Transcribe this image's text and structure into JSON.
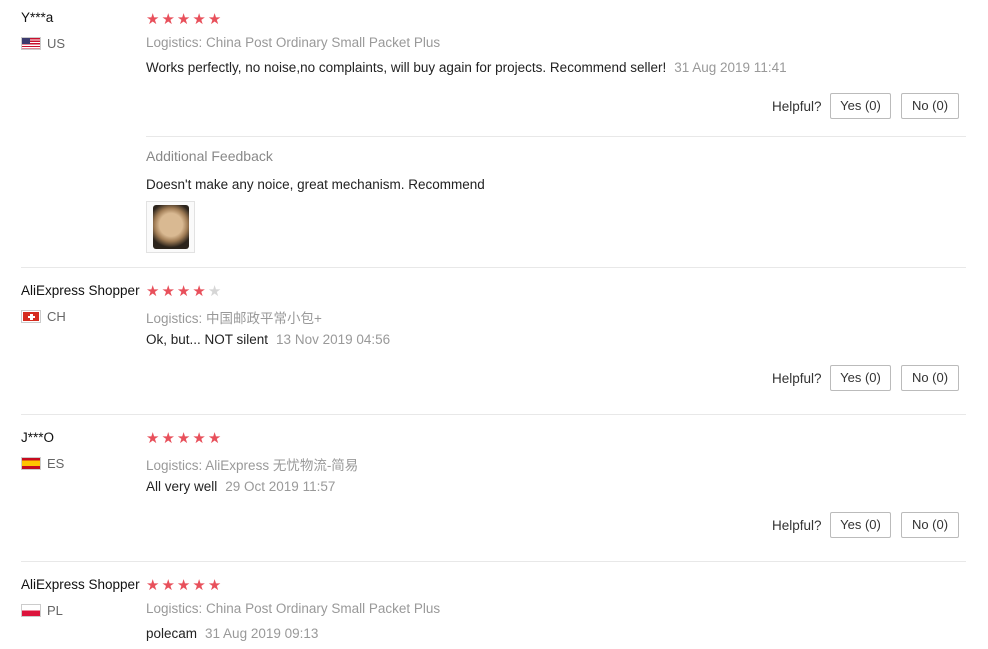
{
  "reviews": [
    {
      "user": "Y***a",
      "country": "US",
      "rating": 5,
      "logistics_label": "Logistics:",
      "logistics_value": "China Post Ordinary Small Packet Plus",
      "text": "Works perfectly, no noise,no complaints, will buy again for projects. Recommend seller!",
      "date": "31 Aug 2019 11:41",
      "helpful_label": "Helpful?",
      "yes_label": "Yes (0)",
      "no_label": "No (0)",
      "additional": {
        "title": "Additional Feedback",
        "text": "Doesn't make any noice, great mechanism. Recommend"
      }
    },
    {
      "user": "AliExpress Shopper",
      "country": "CH",
      "rating": 4,
      "logistics_label": "Logistics:",
      "logistics_value": "中国邮政平常小包+",
      "text": "Ok, but... NOT silent",
      "date": "13 Nov 2019 04:56",
      "helpful_label": "Helpful?",
      "yes_label": "Yes (0)",
      "no_label": "No (0)"
    },
    {
      "user": "J***O",
      "country": "ES",
      "rating": 5,
      "logistics_label": "Logistics:",
      "logistics_value": "AliExpress 无忧物流-简易",
      "text": "All very well",
      "date": "29 Oct 2019 11:57",
      "helpful_label": "Helpful?",
      "yes_label": "Yes (0)",
      "no_label": "No (0)"
    },
    {
      "user": "AliExpress Shopper",
      "country": "PL",
      "rating": 5,
      "logistics_label": "Logistics:",
      "logistics_value": "China Post Ordinary Small Packet Plus",
      "text": "polecam",
      "date": "31 Aug 2019 09:13"
    }
  ],
  "colors": {
    "star_on": "#e8505b",
    "star_off": "#d6d6d6",
    "muted": "#999999"
  }
}
